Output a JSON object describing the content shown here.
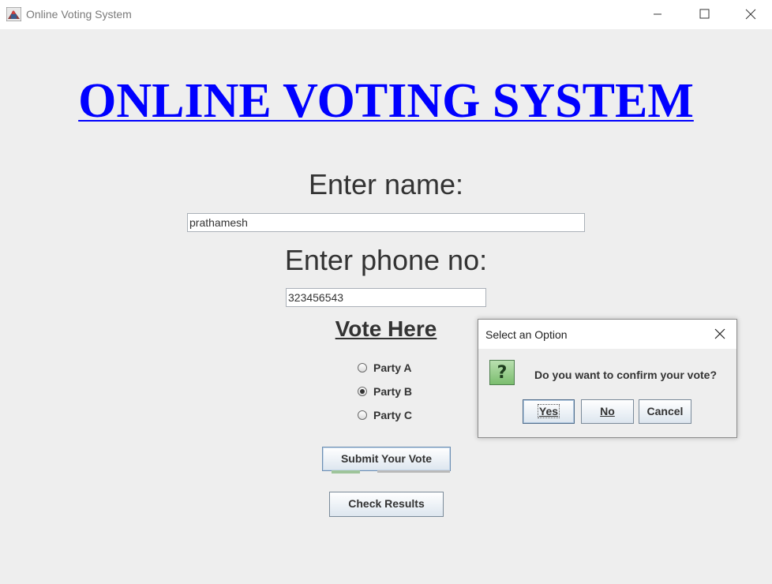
{
  "window": {
    "title": "Online Voting System"
  },
  "main": {
    "heading": "ONLINE VOTING SYSTEM",
    "name_label": "Enter name:",
    "name_value": "prathamesh",
    "phone_label": "Enter phone no:",
    "phone_value": "323456543",
    "vote_heading": "Vote Here",
    "options": [
      {
        "label": "Party A",
        "selected": false
      },
      {
        "label": "Party B",
        "selected": true
      },
      {
        "label": "Party C",
        "selected": false
      }
    ],
    "submit_label": "Submit Your Vote",
    "results_label": "Check Results"
  },
  "dialog": {
    "title": "Select an Option",
    "message": "Do you want to confirm your vote?",
    "icon": "question-icon",
    "yes_label": "Yes",
    "no_label": "No",
    "cancel_label": "Cancel"
  },
  "colors": {
    "heading": "#0000ff",
    "background": "#eeeeee",
    "text": "#333333"
  }
}
